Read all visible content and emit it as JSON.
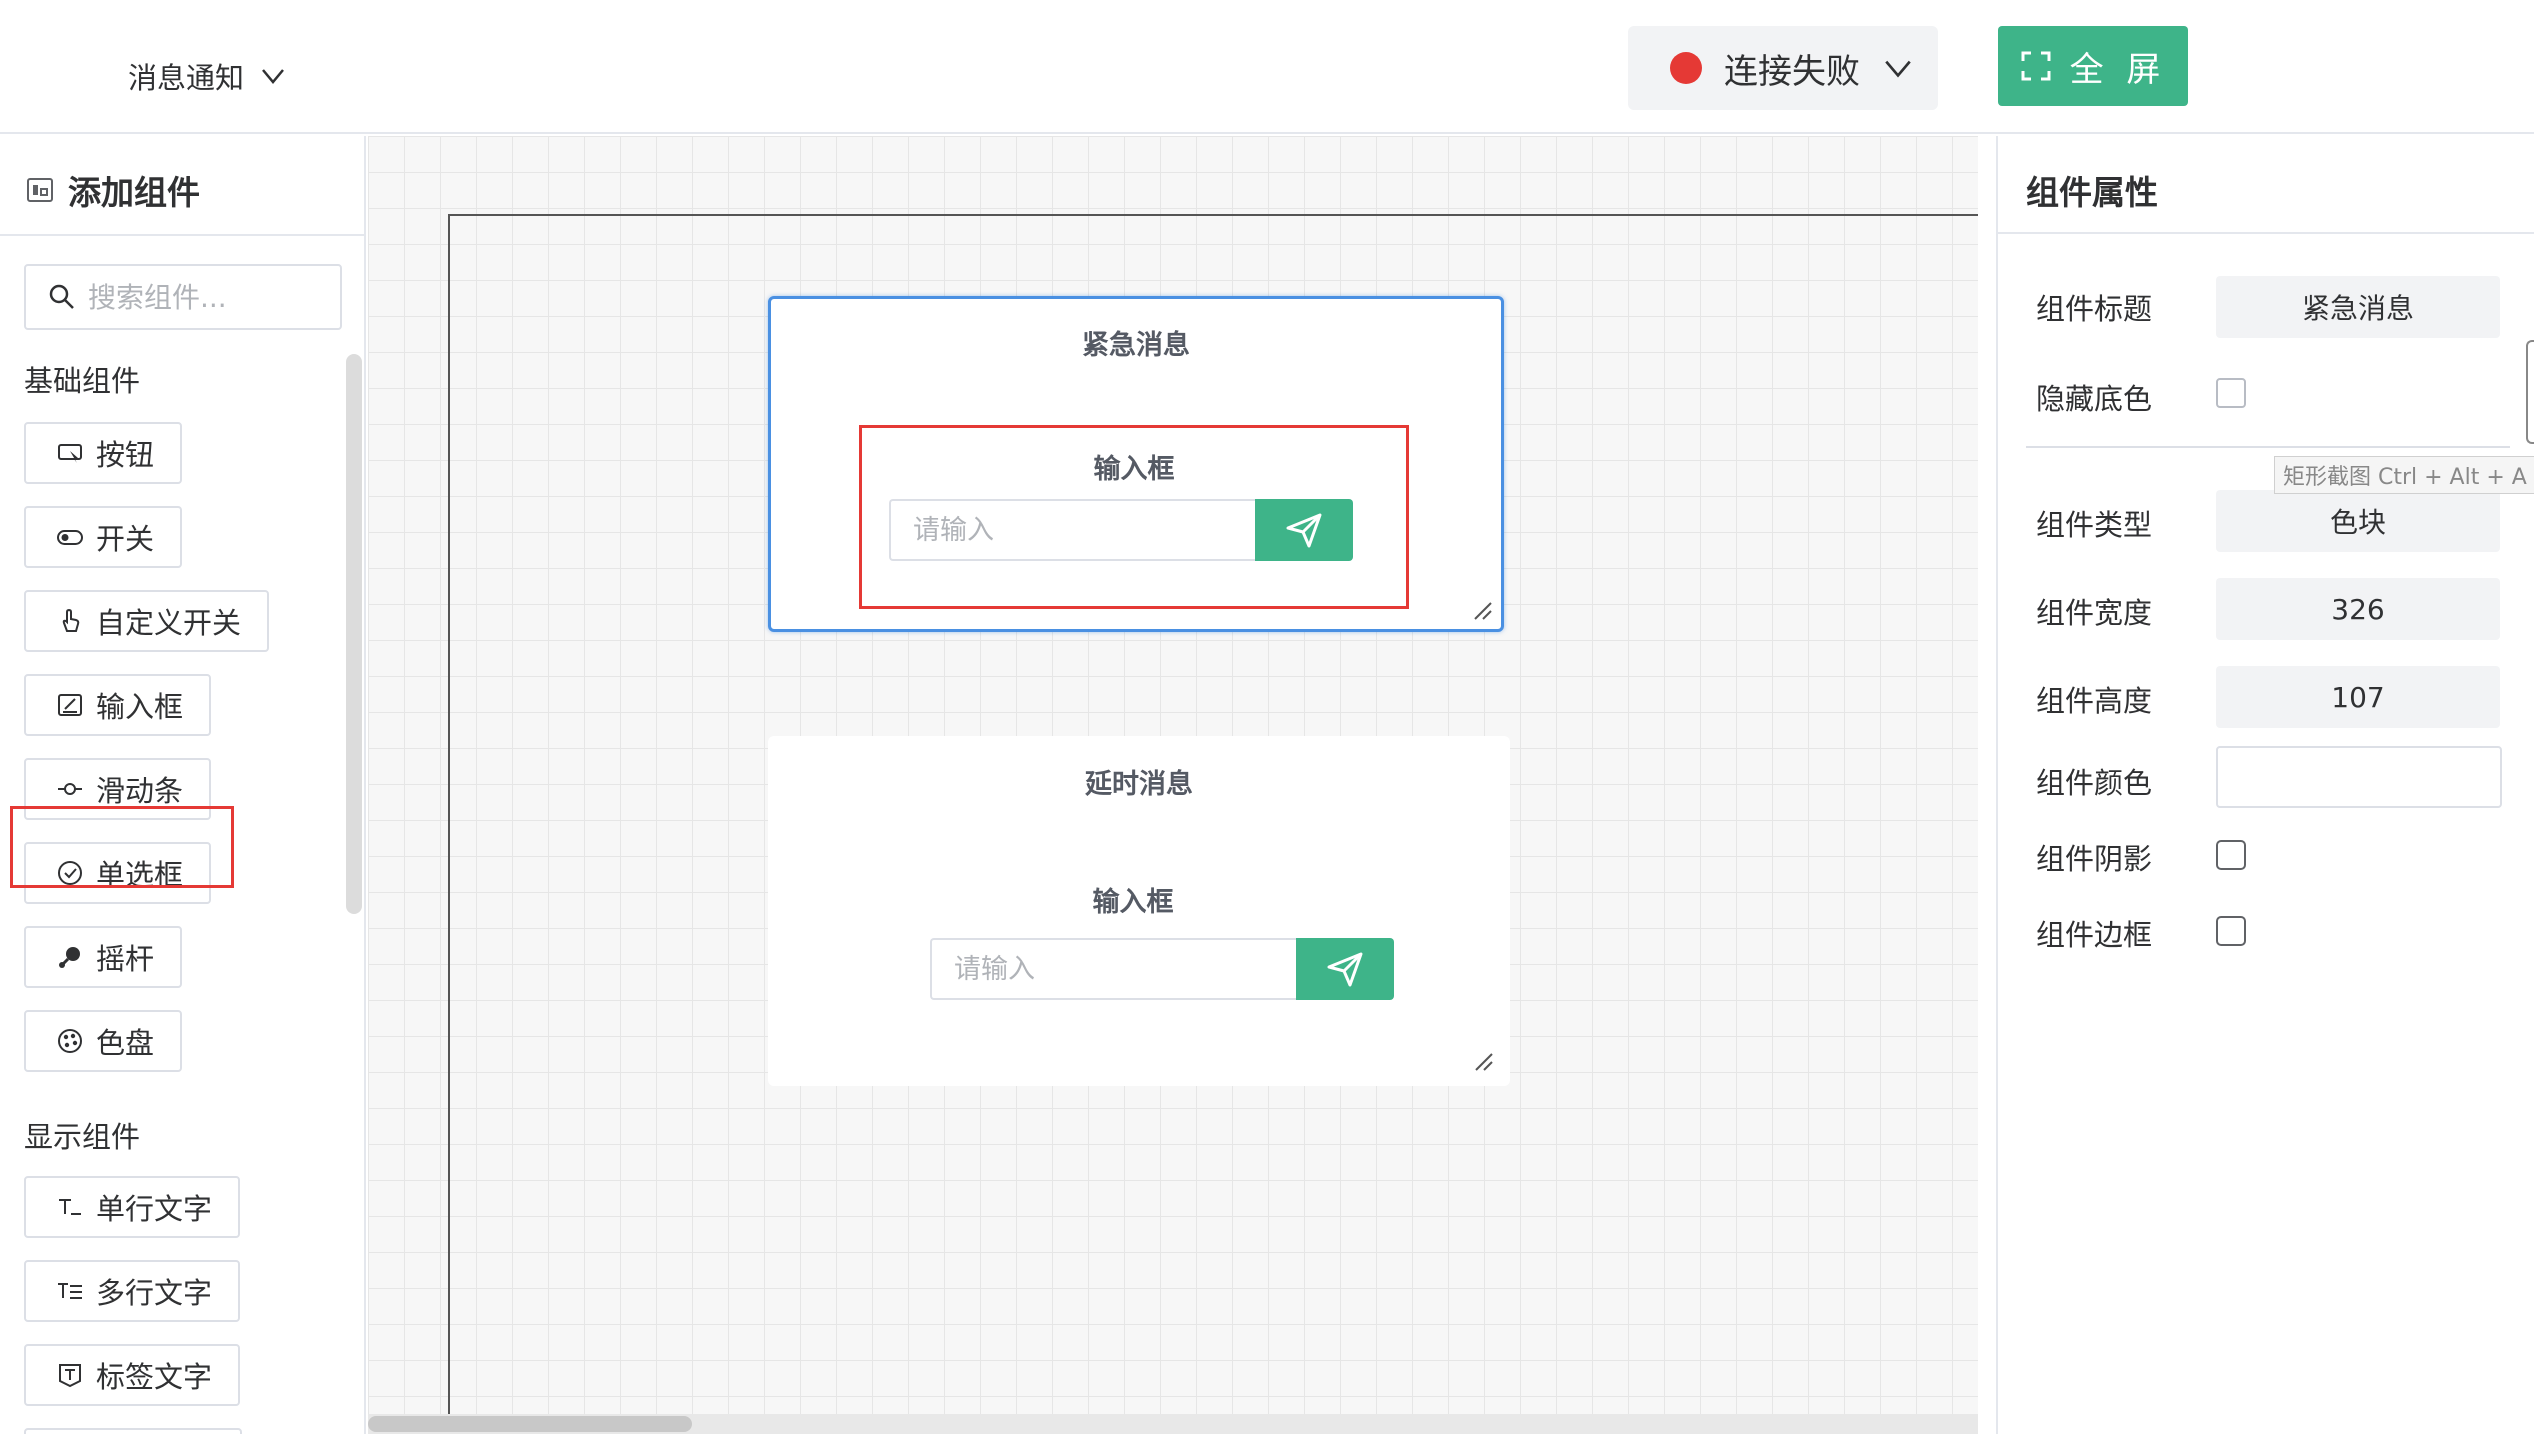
{
  "header": {
    "page_selector": "消息通知",
    "status_label": "连接失败",
    "fullscreen_label": "全 屏",
    "status_color": "#e53935",
    "accent_color": "#3eb489"
  },
  "sidebar": {
    "title": "添加组件",
    "search_placeholder": "搜索组件...",
    "basic_group_label": "基础组件",
    "basic_components": [
      {
        "label": "按钮",
        "icon": "button-icon"
      },
      {
        "label": "开关",
        "icon": "toggle-icon"
      },
      {
        "label": "自定义开关",
        "icon": "hand-pointer-icon"
      },
      {
        "label": "输入框",
        "icon": "edit-box-icon"
      },
      {
        "label": "滑动条",
        "icon": "slider-icon"
      },
      {
        "label": "单选框",
        "icon": "check-circle-icon"
      },
      {
        "label": "摇杆",
        "icon": "joystick-icon"
      },
      {
        "label": "色盘",
        "icon": "palette-icon"
      }
    ],
    "display_group_label": "显示组件",
    "display_components": [
      {
        "label": "单行文字",
        "icon": "single-line-text-icon"
      },
      {
        "label": "多行文字",
        "icon": "multi-line-text-icon"
      },
      {
        "label": "标签文字",
        "icon": "tag-text-icon"
      }
    ]
  },
  "canvas": {
    "widgets": [
      {
        "title": "紧急消息",
        "input_title": "输入框",
        "input_placeholder": "请输入",
        "selected": true
      },
      {
        "title": "延时消息",
        "input_title": "输入框",
        "input_placeholder": "请输入",
        "selected": false
      }
    ]
  },
  "properties": {
    "title": "组件属性",
    "labels": {
      "widget_title": "组件标题",
      "hide_bg": "隐藏底色",
      "widget_type": "组件类型",
      "widget_width": "组件宽度",
      "widget_height": "组件高度",
      "widget_color": "组件颜色",
      "widget_shadow": "组件阴影",
      "widget_border": "组件边框"
    },
    "values": {
      "widget_title": "紧急消息",
      "widget_type": "色块",
      "widget_width": "326",
      "widget_height": "107"
    },
    "hide_bg_checked": false,
    "shadow_checked": false,
    "border_checked": false
  },
  "tooltip": "矩形截图 Ctrl + Alt + A"
}
